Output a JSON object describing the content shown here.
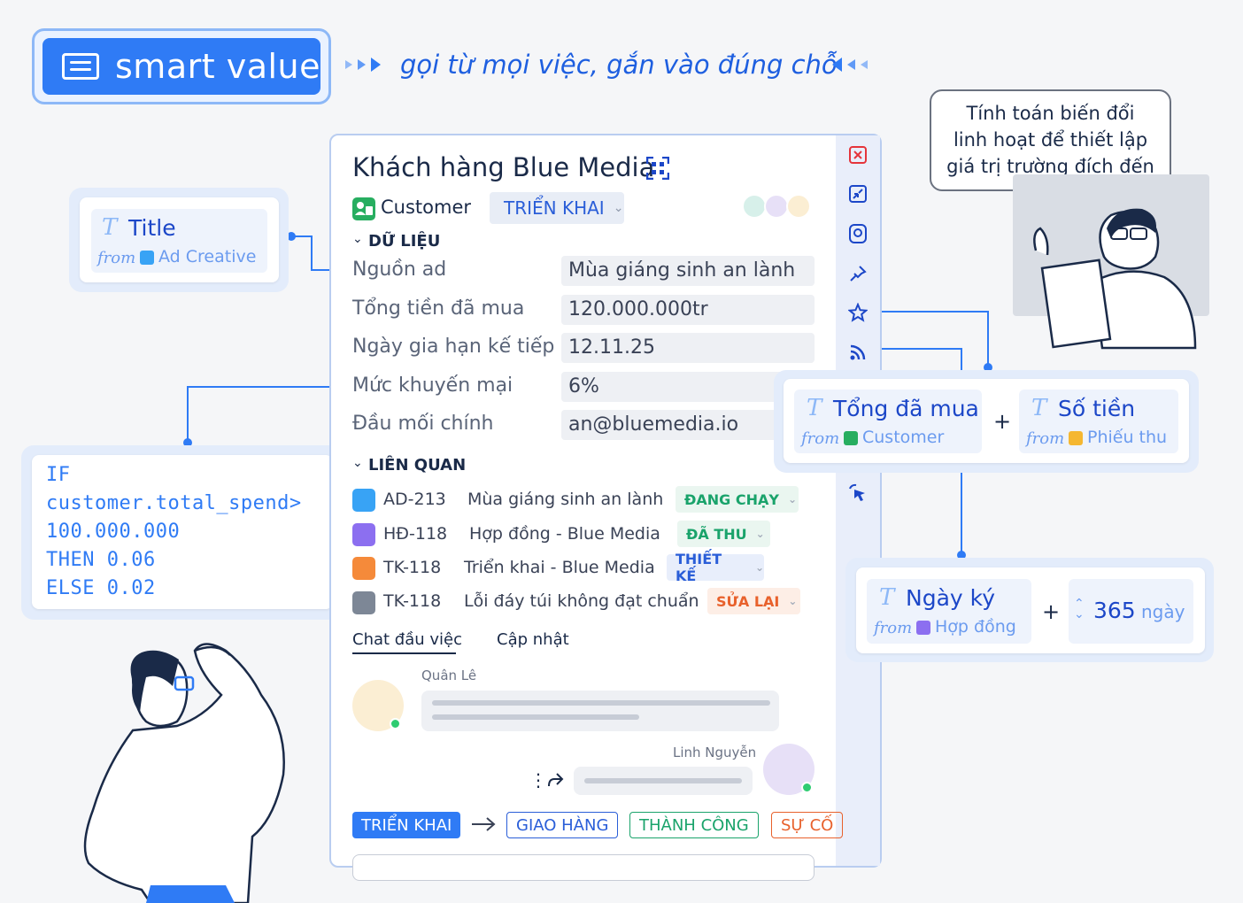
{
  "header": {
    "brand_label": "smart value",
    "tagline": "gọi từ mọi việc, gắn vào đúng chỗ",
    "accent_color": "#2f7bf5"
  },
  "record": {
    "title": "Khách hàng Blue Media",
    "type_label": "Customer",
    "status": "TRIỂN KHAI",
    "sections": {
      "data": "DỮ LIỆU",
      "related": "LIÊN QUAN"
    },
    "fields": [
      {
        "label": "Nguồn ad",
        "value": "Mùa giáng sinh an lành"
      },
      {
        "label": "Tổng tiền đã mua",
        "value": "120.000.000tr"
      },
      {
        "label": "Ngày gia hạn kế tiếp",
        "value": "12.11.25"
      },
      {
        "label": "Mức khuyến mại",
        "value": "6%"
      },
      {
        "label": "Đầu mối chính",
        "value": "an@bluemedia.io"
      }
    ],
    "related": [
      {
        "code": "AD-213",
        "name": "Mùa giáng sinh an lành",
        "badge": "ĐANG CHẠY",
        "badge_color": "#1aa36b",
        "icon_color": "#38a3f5"
      },
      {
        "code": "HĐ-118",
        "name": "Hợp đồng - Blue Media",
        "badge": "ĐÃ THU",
        "badge_color": "#1aa36b",
        "icon_color": "#8c6ff0"
      },
      {
        "code": "TK-118",
        "name": "Triển khai - Blue Media",
        "badge": "THIẾT KẾ",
        "badge_color": "#2a5ed8",
        "icon_color": "#f58a3a"
      },
      {
        "code": "TK-118",
        "name": "Lỗi đáy túi không đạt chuẩn",
        "badge": "SỬA LẠI",
        "badge_color": "#e8612c",
        "icon_color": "#7d8796"
      }
    ],
    "tabs": [
      "Chat đầu việc",
      "Cập nhật"
    ],
    "chat": [
      {
        "author": "Quân Lê"
      },
      {
        "author": "Linh Nguyễn"
      }
    ],
    "workflow": [
      {
        "label": "TRIỂN KHAI",
        "active": true
      },
      {
        "label": "GIAO HÀNG",
        "color": "#2a5ed8"
      },
      {
        "label": "THÀNH CÔNG",
        "color": "#1aa36b"
      },
      {
        "label": "SỰ CỐ",
        "color": "#e8612c"
      }
    ]
  },
  "callouts": {
    "title_chip": {
      "name": "Title",
      "from_word": "from",
      "source": "Ad Creative"
    },
    "formula": [
      "IF",
      "customer.total_spend>",
      "100.000.000",
      "THEN 0.06",
      "ELSE 0.02"
    ],
    "sum_chips": [
      {
        "name": "Tổng đã mua",
        "from_word": "from",
        "source": "Customer"
      },
      {
        "name": "Số tiền",
        "from_word": "from",
        "source": "Phiếu thu"
      }
    ],
    "plus": "+",
    "date_chip": {
      "name": "Ngày ký",
      "from_word": "from",
      "source": "Hợp đồng"
    },
    "days": {
      "value": "365",
      "unit": "ngày"
    },
    "speech": [
      "Tính toán biến đổi",
      "linh hoạt để thiết lập",
      "giá trị trường đích đến"
    ]
  }
}
